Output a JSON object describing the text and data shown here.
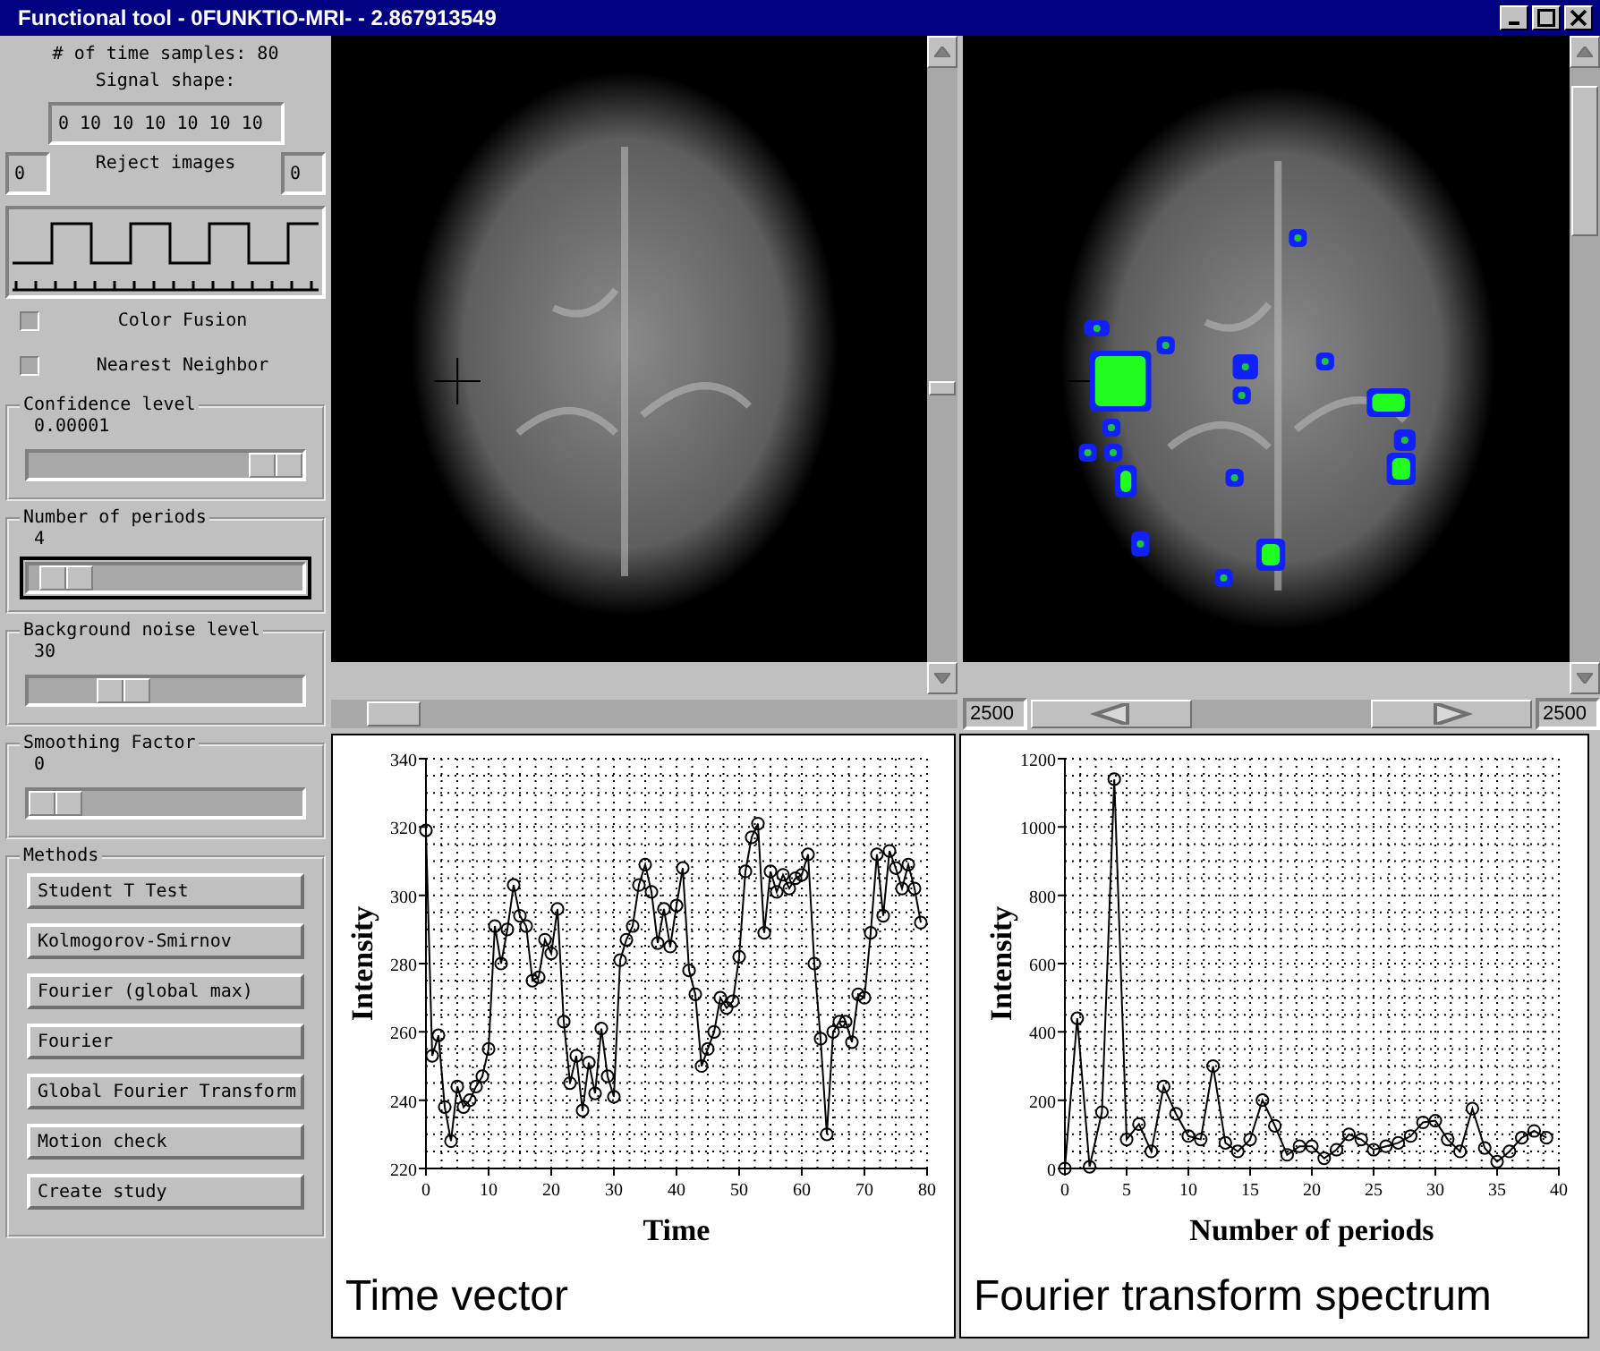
{
  "window": {
    "title": "Functional tool - 0FUNKTIO-MRI- - 2.867913549"
  },
  "left_panel": {
    "samples_label": "# of time samples: 80",
    "signal_shape": {
      "label": "Signal shape:",
      "value": "0 10 10 10 10 10 10"
    },
    "reject_images": {
      "label": "Reject images",
      "from": "0",
      "to": "0"
    },
    "checkboxes": [
      {
        "label": "Color Fusion",
        "checked": false
      },
      {
        "label": "Nearest Neighbor",
        "checked": false
      }
    ],
    "sliders": [
      {
        "label": "Confidence level",
        "reading": "0.00001",
        "level": 1.0,
        "focused": false
      },
      {
        "label": "Number of periods",
        "reading": "4",
        "level": 0.05,
        "focused": true
      },
      {
        "label": "Background noise level",
        "reading": "30",
        "level": 0.31,
        "focused": false
      },
      {
        "label": "Smoothing Factor",
        "reading": "0",
        "level": 0.0,
        "focused": false
      }
    ],
    "methods": {
      "label": "Methods",
      "buttons": [
        "Student T Test",
        "Kolmogorov-Smirnov",
        "Fourier (global max)",
        "Fourier",
        "Global Fourier Transform",
        "Motion check",
        "Create study"
      ]
    }
  },
  "images": [
    {
      "activation_overlay": false
    },
    {
      "activation_overlay": true,
      "range_start": "2500",
      "range_end": "2500"
    }
  ],
  "charts": [
    {
      "caption": "Time vector",
      "chart_data": {
        "type": "line",
        "xlabel": "Time",
        "ylabel": "Intensity",
        "xlim": [
          0,
          80
        ],
        "ylim": [
          220,
          340
        ],
        "xticks": [
          0,
          10,
          20,
          30,
          40,
          50,
          60,
          70,
          80
        ],
        "yticks": [
          220,
          240,
          260,
          280,
          300,
          320,
          340
        ],
        "x": [
          0,
          1,
          2,
          3,
          4,
          5,
          6,
          7,
          8,
          9,
          10,
          11,
          12,
          13,
          14,
          15,
          16,
          17,
          18,
          19,
          20,
          21,
          22,
          23,
          24,
          25,
          26,
          27,
          28,
          29,
          30,
          31,
          32,
          33,
          34,
          35,
          36,
          37,
          38,
          39,
          40,
          41,
          42,
          43,
          44,
          45,
          46,
          47,
          48,
          49,
          50,
          51,
          52,
          53,
          54,
          55,
          56,
          57,
          58,
          59,
          60,
          61,
          62,
          63,
          64,
          65,
          66,
          67,
          68,
          69,
          70,
          71,
          72,
          73,
          74,
          75,
          76,
          77,
          78,
          79
        ],
        "grid": true,
        "series": [
          {
            "color": "#000000",
            "marker": "circle",
            "values": [
              319,
              253,
              259,
              238,
              228,
              244,
              238,
              240,
              244,
              247,
              255,
              291,
              280,
              290,
              303,
              294,
              291,
              275,
              276,
              287,
              283,
              296,
              263,
              245,
              253,
              237,
              251,
              242,
              261,
              247,
              241,
              281,
              287,
              291,
              303,
              309,
              301,
              286,
              296,
              285,
              297,
              308,
              278,
              271,
              250,
              255,
              260,
              270,
              267,
              269,
              282,
              307,
              317,
              321,
              289,
              307,
              301,
              306,
              302,
              305,
              306,
              312,
              280,
              258,
              230,
              260,
              263,
              263,
              257,
              271,
              270,
              289,
              312,
              294,
              313,
              308,
              302,
              309,
              302,
              292
            ]
          }
        ]
      }
    },
    {
      "caption": "Fourier transform spectrum",
      "chart_data": {
        "type": "line",
        "xlabel": "Number of periods",
        "ylabel": "Intensity",
        "xlim": [
          0,
          40
        ],
        "ylim": [
          0,
          1200
        ],
        "xticks": [
          0,
          5,
          10,
          15,
          20,
          25,
          30,
          35,
          40
        ],
        "yticks": [
          0,
          200,
          400,
          600,
          800,
          1000,
          1200
        ],
        "x": [
          0,
          1,
          2,
          3,
          4,
          5,
          6,
          7,
          8,
          9,
          10,
          11,
          12,
          13,
          14,
          15,
          16,
          17,
          18,
          19,
          20,
          21,
          22,
          23,
          24,
          25,
          26,
          27,
          28,
          29,
          30,
          31,
          32,
          33,
          34,
          35,
          36,
          37,
          38,
          39
        ],
        "grid": true,
        "series": [
          {
            "color": "#000000",
            "marker": "circle",
            "values": [
              0,
              440,
              5,
              165,
              1140,
              85,
              130,
              50,
              240,
              160,
              95,
              85,
              300,
              75,
              50,
              85,
              200,
              125,
              40,
              65,
              65,
              30,
              55,
              100,
              85,
              55,
              65,
              75,
              95,
              135,
              140,
              85,
              50,
              175,
              60,
              20,
              50,
              90,
              110,
              90
            ]
          }
        ]
      }
    }
  ]
}
